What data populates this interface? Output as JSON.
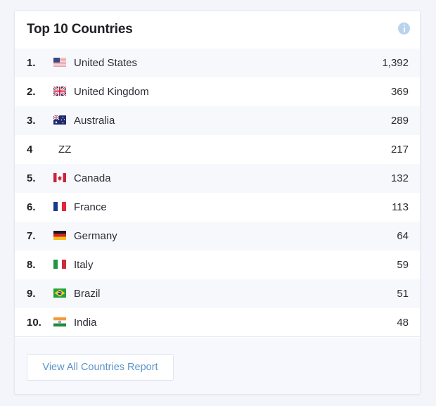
{
  "widget": {
    "title": "Top 10 Countries",
    "info_icon": "info-circle-icon",
    "accent_color": "#5b95c9"
  },
  "countries": [
    {
      "rank": "1.",
      "name": "United States",
      "count": "1,392",
      "flag": "us-flag-icon"
    },
    {
      "rank": "2.",
      "name": "United Kingdom",
      "count": "369",
      "flag": "uk-flag-icon"
    },
    {
      "rank": "3.",
      "name": "Australia",
      "count": "289",
      "flag": "au-flag-icon"
    },
    {
      "rank": "4",
      "name": "ZZ",
      "count": "217",
      "flag": null
    },
    {
      "rank": "5.",
      "name": "Canada",
      "count": "132",
      "flag": "ca-flag-icon"
    },
    {
      "rank": "6.",
      "name": "France",
      "count": "113",
      "flag": "fr-flag-icon"
    },
    {
      "rank": "7.",
      "name": "Germany",
      "count": "64",
      "flag": "de-flag-icon"
    },
    {
      "rank": "8.",
      "name": "Italy",
      "count": "59",
      "flag": "it-flag-icon"
    },
    {
      "rank": "9.",
      "name": "Brazil",
      "count": "51",
      "flag": "br-flag-icon"
    },
    {
      "rank": "10.",
      "name": "India",
      "count": "48",
      "flag": "in-flag-icon"
    }
  ],
  "footer": {
    "button_label": "View All Countries Report"
  }
}
